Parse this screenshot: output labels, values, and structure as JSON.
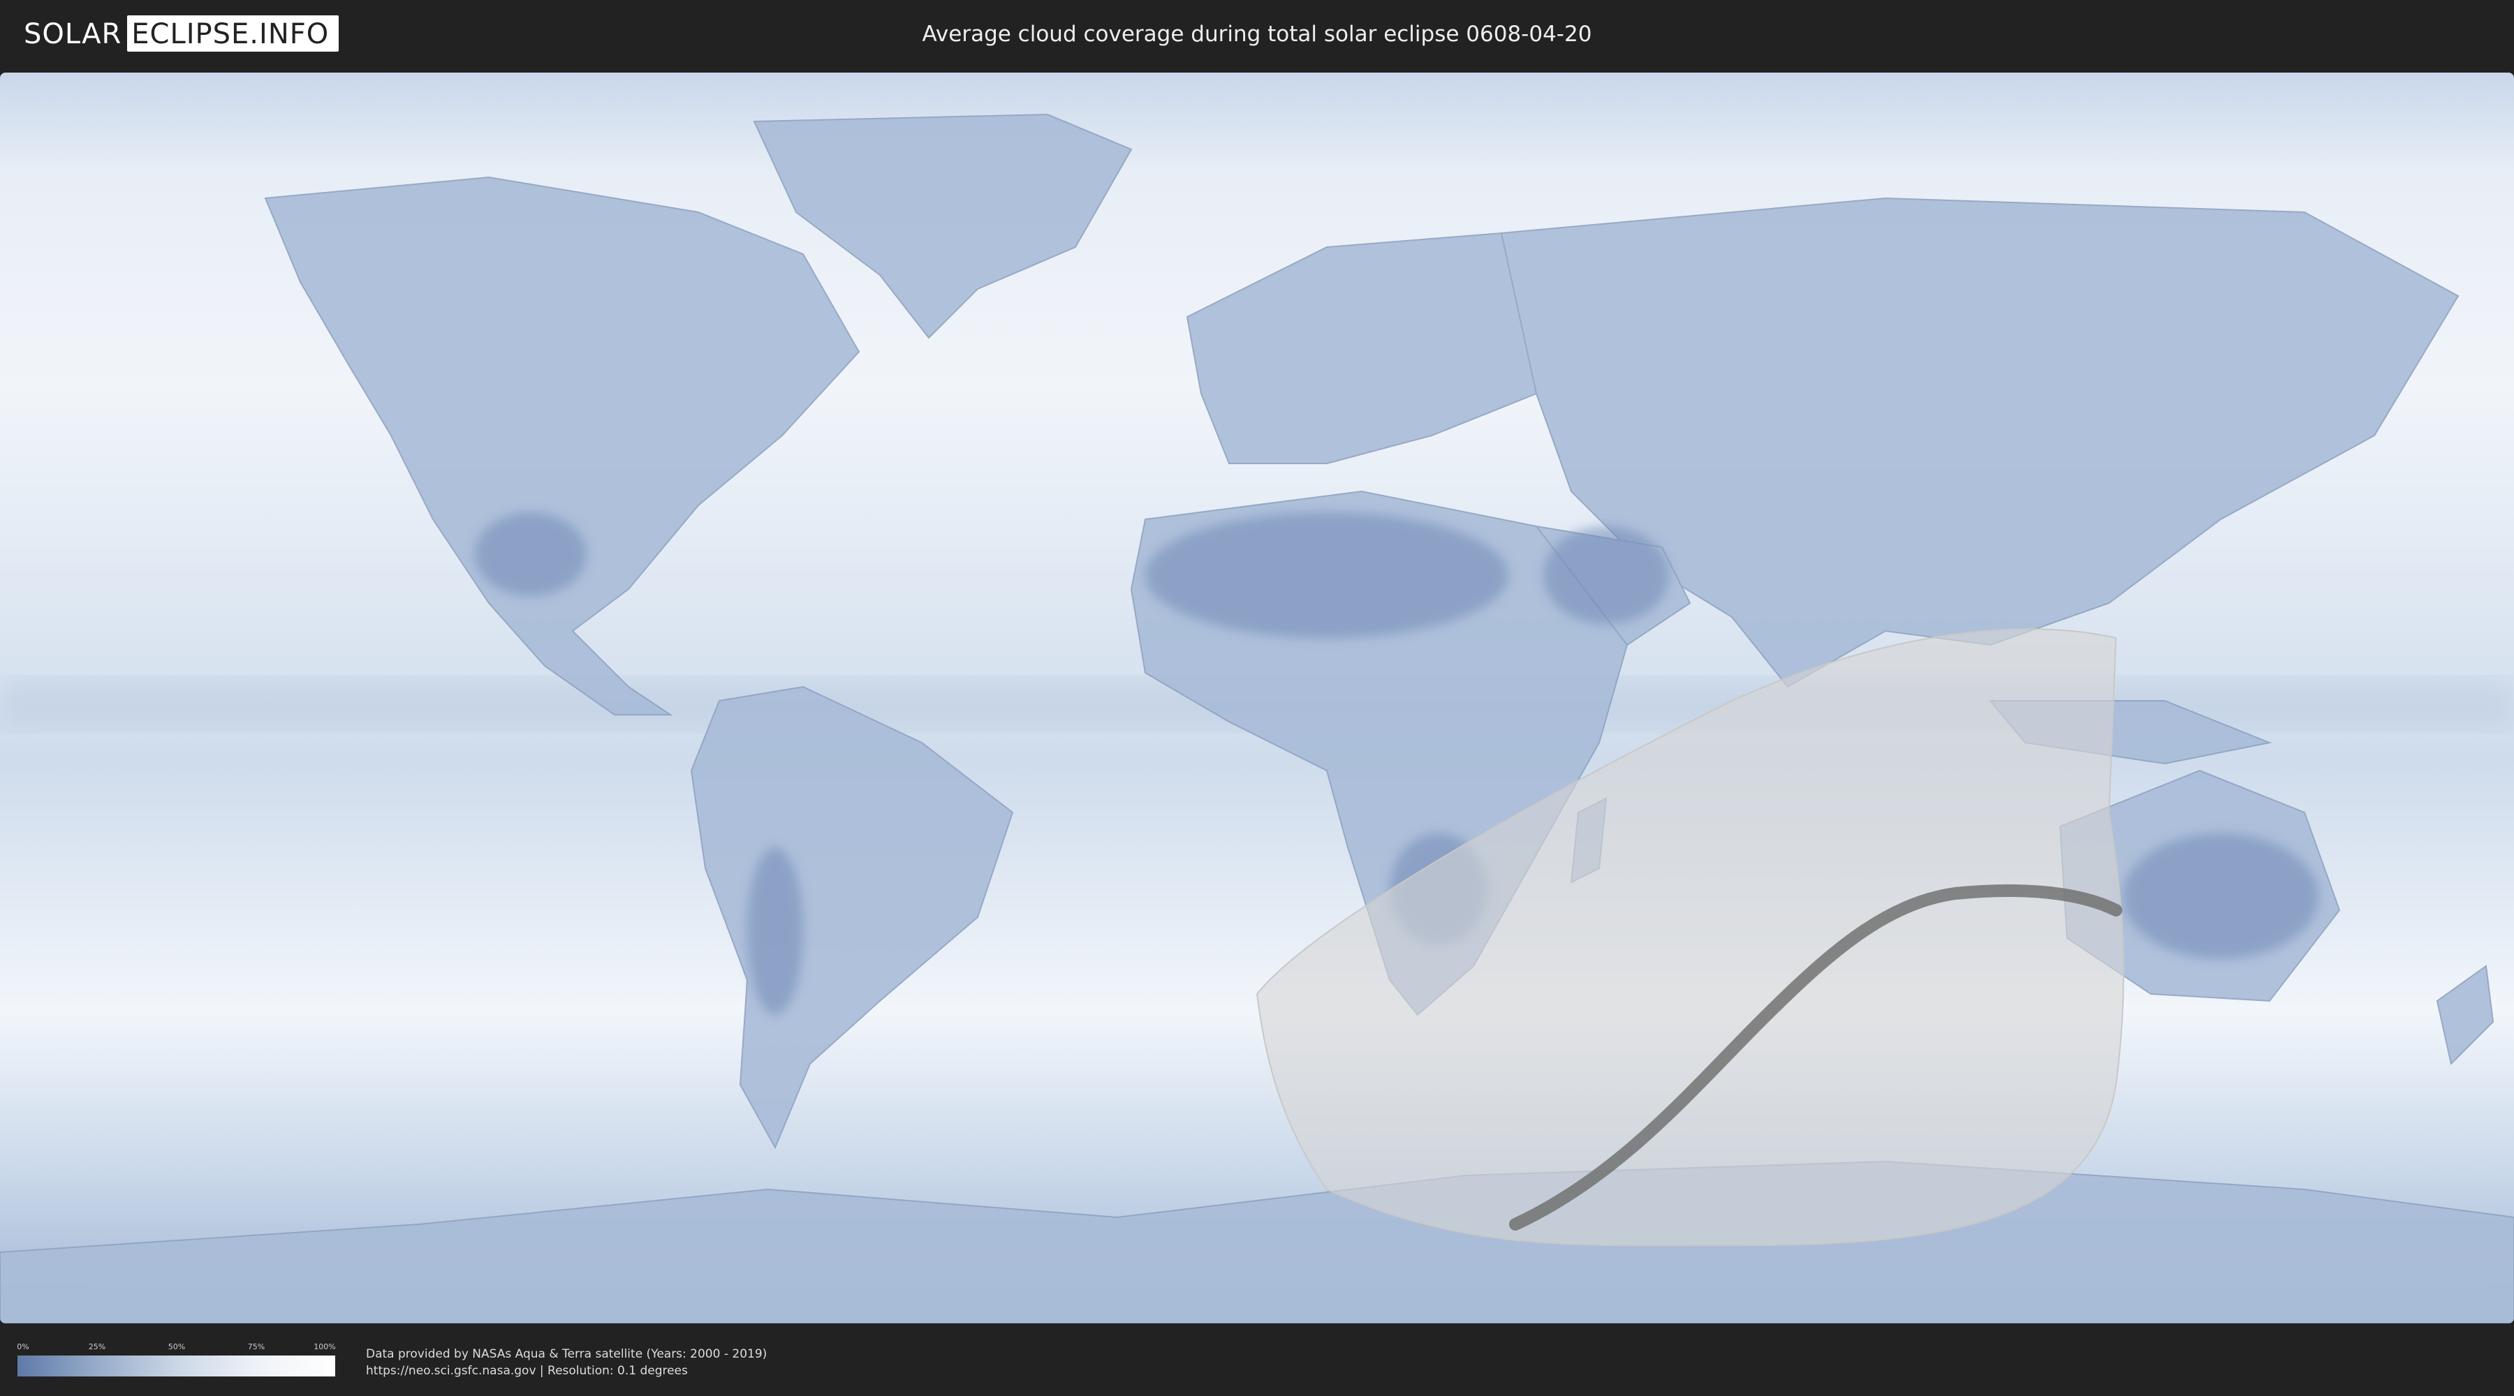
{
  "header": {
    "logo_part1": "SOLAR",
    "logo_part2": "ECLIPSE.INFO",
    "title": "Average cloud coverage during total solar eclipse 0608-04-20"
  },
  "map": {
    "description_colors": {
      "clear_sky": "#5f7aa8",
      "full_cloud": "#ffffff",
      "eclipse_zone": "#d8d8d8",
      "totality_path": "#6b6b6b"
    }
  },
  "legend": {
    "ticks": [
      "0%",
      "25%",
      "50%",
      "75%",
      "100%"
    ]
  },
  "footer": {
    "credit_line1": "Data provided by NASAs Aqua & Terra satellite (Years: 2000 - 2019)",
    "credit_line2": "https://neo.sci.gsfc.nasa.gov | Resolution: 0.1 degrees"
  }
}
